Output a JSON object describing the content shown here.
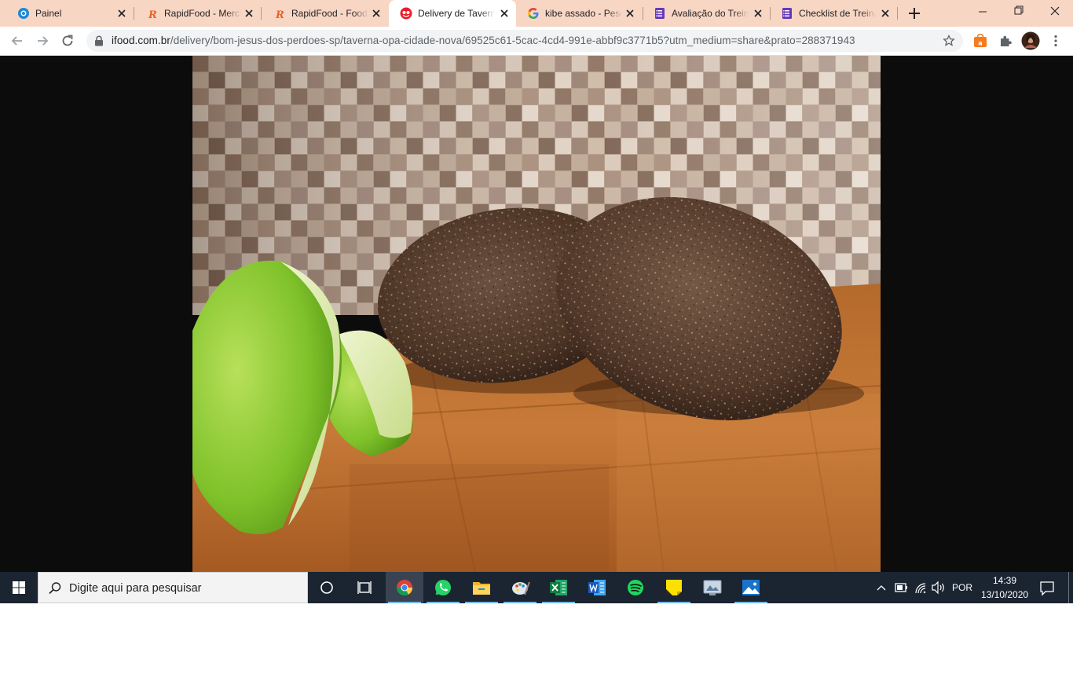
{
  "browser": {
    "tabs": [
      {
        "title": "Painel",
        "icon": "edge-blue-icon"
      },
      {
        "title": "RapidFood - Merch",
        "icon": "rapidfood-icon"
      },
      {
        "title": "RapidFood - FoodP",
        "icon": "rapidfood-icon"
      },
      {
        "title": "Delivery de Tavern",
        "icon": "ifood-icon",
        "active": true
      },
      {
        "title": "kibe assado - Pesq",
        "icon": "google-icon"
      },
      {
        "title": "Avaliação do Trein",
        "icon": "forms-icon"
      },
      {
        "title": "Checklist de Treina",
        "icon": "forms-icon"
      }
    ],
    "url_host": "ifood.com.br",
    "url_path": "/delivery/bom-jesus-dos-perdoes-sp/taverna-opa-cidade-nova/69525c61-5cac-4cd4-991e-abbf9c3771b5?utm_medium=share&prato=288371943"
  },
  "content": {
    "image": "kibe assado com limão sobre tábua de madeira"
  },
  "taskbar": {
    "search_placeholder": "Digite aqui para pesquisar",
    "pinned": [
      "chrome-icon",
      "whatsapp-icon",
      "file-explorer-icon",
      "paint-icon",
      "excel-icon",
      "word-icon",
      "spotify-icon",
      "sticky-notes-icon",
      "snipping-tool-icon",
      "photos-icon"
    ],
    "language": "POR",
    "time": "14:39",
    "date": "13/10/2020"
  },
  "colors": {
    "tabstrip": "#f8d6c4",
    "taskbar": "#1b2431",
    "accent_indicator": "#76b9ed"
  }
}
